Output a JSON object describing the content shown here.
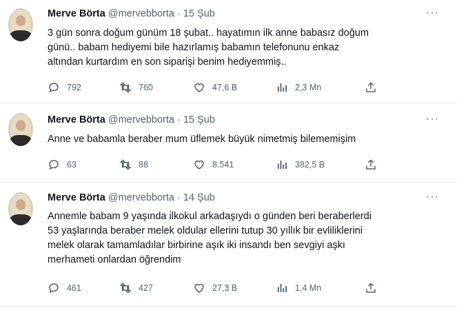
{
  "tweets": [
    {
      "name": "Merve Börta",
      "handle": "@mervebborta",
      "date": "15 Şub",
      "text_lines": [
        "3 gün sonra doğum günüm 18 şubat.. hayatımın ilk anne babasız doğum",
        "günü.. babam hediyemi bile hazırlamış babamın telefonunu enkaz",
        "altından kurtardım en son siparişi benim hediyemmiş.."
      ],
      "replies": "792",
      "retweets": "760",
      "likes": "47,6 B",
      "views": "2,3 Mn"
    },
    {
      "name": "Merve Börta",
      "handle": "@mervebborta",
      "date": "15 Şub",
      "text_lines": [
        "Anne ve babamla beraber mum üflemek büyük nimetmiş bilememişim"
      ],
      "replies": "63",
      "retweets": "88",
      "likes": "8.541",
      "views": "382,5 B"
    },
    {
      "name": "Merve Börta",
      "handle": "@mervebborta",
      "date": "14 Şub",
      "text_lines": [
        "Annemle babam 9 yaşında ilkokul arkadaşıydı o günden beri beraberlerdi",
        "53 yaşlarında beraber melek oldular ellerini tutup 30 yıllık bir evliliklerini",
        "melek olarak tamamladılar birbirine aşık iki insandı ben sevgiyi aşkı",
        "merhameti onlardan öğrendim"
      ],
      "replies": "461",
      "retweets": "427",
      "likes": "27,3 B",
      "views": "1,4 Mn"
    }
  ],
  "separator": "·",
  "more_glyph": "···"
}
